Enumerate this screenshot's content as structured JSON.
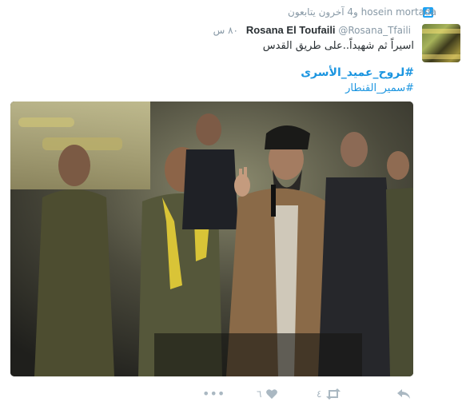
{
  "context": {
    "follow_text": "hosein mortada و4 آخرون يتابعون"
  },
  "tweet": {
    "author_name": "Rosana El Toufaili",
    "handle": "@Rosana_Tfaili",
    "time": "٨٠ س",
    "text": "اسيراً ثم شهيداً..على طريق القدس",
    "hashtags": [
      "#لروح_عميد_الأسرى",
      "#سمير_القنطار"
    ]
  },
  "actions": {
    "reply_icon": "reply-icon",
    "retweet_icon": "retweet-icon",
    "retweet_count": "٤",
    "like_icon": "heart-icon",
    "like_count": "٦",
    "more_icon": "more-icon"
  },
  "colors": {
    "link": "#1b95e0",
    "muted": "#8899a6",
    "icon": "#aab8c2",
    "text": "#292f33"
  }
}
